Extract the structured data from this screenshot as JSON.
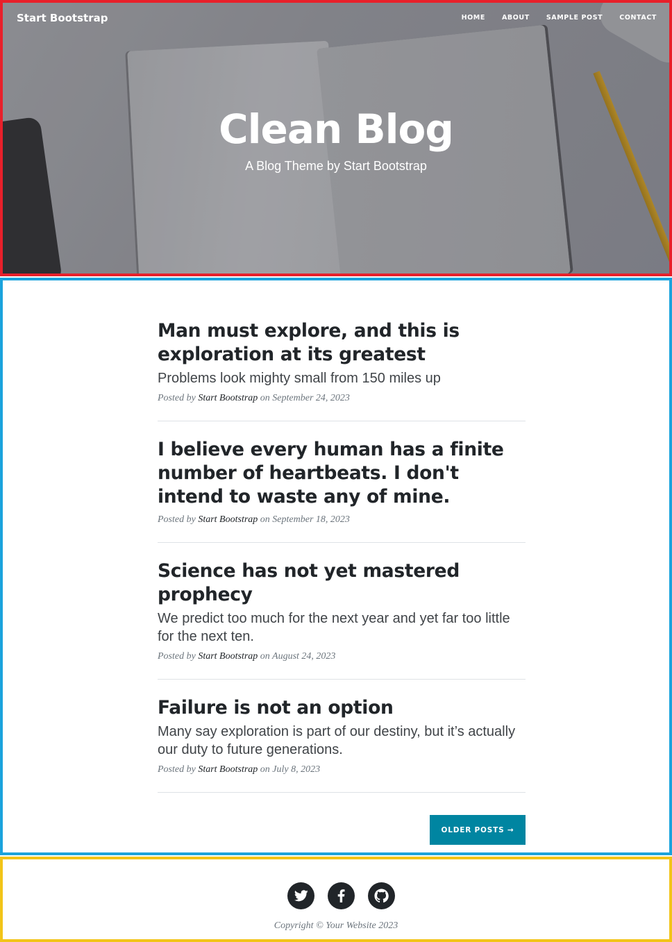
{
  "nav": {
    "brand": "Start Bootstrap",
    "links": [
      "HOME",
      "ABOUT",
      "SAMPLE POST",
      "CONTACT"
    ]
  },
  "hero": {
    "title": "Clean Blog",
    "subtitle": "A Blog Theme by Start Bootstrap"
  },
  "posts": [
    {
      "title": "Man must explore, and this is exploration at its greatest",
      "subtitle": "Problems look mighty small from 150 miles up",
      "meta_prefix": "Posted by",
      "author": "Start Bootstrap",
      "meta_date": "on September 24, 2023"
    },
    {
      "title": "I believe every human has a finite number of heartbeats. I don't intend to waste any of mine.",
      "subtitle": "",
      "meta_prefix": "Posted by",
      "author": "Start Bootstrap",
      "meta_date": "on September 18, 2023"
    },
    {
      "title": "Science has not yet mastered prophecy",
      "subtitle": "We predict too much for the next year and yet far too little for the next ten.",
      "meta_prefix": "Posted by",
      "author": "Start Bootstrap",
      "meta_date": "on August 24, 2023"
    },
    {
      "title": "Failure is not an option",
      "subtitle": "Many say exploration is part of our destiny, but it’s actually our duty to future generations.",
      "meta_prefix": "Posted by",
      "author": "Start Bootstrap",
      "meta_date": "on July 8, 2023"
    }
  ],
  "pager": {
    "older_label": "OLDER POSTS →"
  },
  "footer": {
    "social_icons": [
      "twitter-icon",
      "facebook-icon",
      "github-icon"
    ],
    "copyright": "Copyright © Your Website 2023"
  },
  "colors": {
    "accent": "#0085a1",
    "text": "#212529",
    "muted": "#6c757d"
  }
}
